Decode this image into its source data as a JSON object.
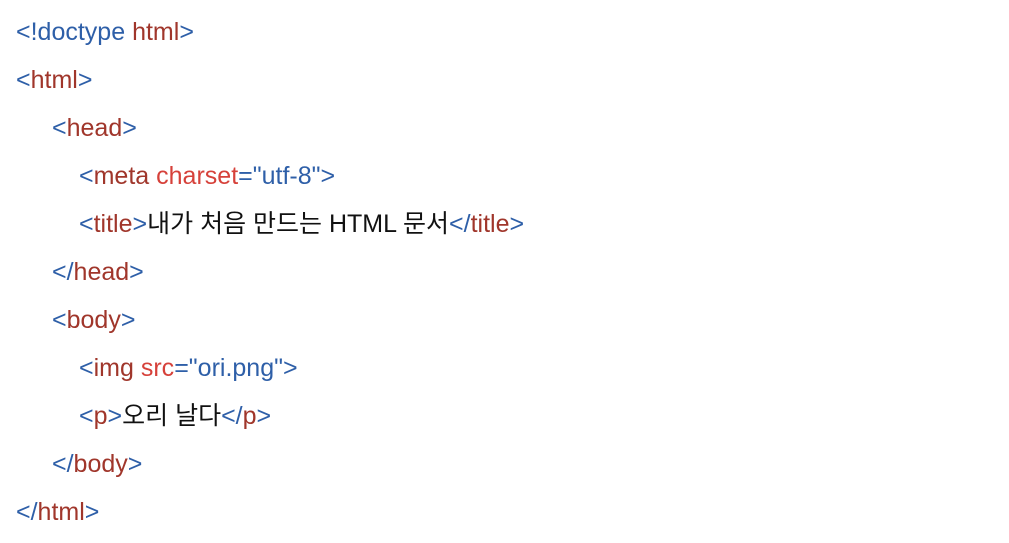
{
  "lines": [
    {
      "open": "<",
      "doctype": "!doctype",
      "space": " ",
      "tag": "html",
      "close": ">"
    },
    {
      "open": "<",
      "tag": "html",
      "close": ">"
    },
    {
      "open": "<",
      "tag": "head",
      "close": ">"
    },
    {
      "open": "<",
      "tag": "meta",
      "space": " ",
      "attr": "charset",
      "eq": "=",
      "value": "\"utf-8\"",
      "close": ">"
    },
    {
      "open": "<",
      "tag": "title",
      "close": ">",
      "text": "내가 처음 만드는 HTML 문서",
      "end_open": "</",
      "end_tag": "title",
      "end_close": ">"
    },
    {
      "open": "</",
      "tag": "head",
      "close": ">"
    },
    {
      "open": "<",
      "tag": "body",
      "close": ">"
    },
    {
      "open": "<",
      "tag": "img",
      "space": " ",
      "attr": "src",
      "eq": "=",
      "value": "\"ori.png\"",
      "close": ">"
    },
    {
      "open": "<",
      "tag": "p",
      "close": ">",
      "text": "오리 날다",
      "end_open": "</",
      "end_tag": "p",
      "end_close": ">"
    },
    {
      "open": "</",
      "tag": "body",
      "close": ">"
    },
    {
      "open": "</",
      "tag": "html",
      "close": ">"
    }
  ],
  "colors": {
    "bracket": "#2e5fa8",
    "tag_name": "#a0362b",
    "attribute": "#d6413a",
    "text": "#111111",
    "background": "#ffffff"
  }
}
